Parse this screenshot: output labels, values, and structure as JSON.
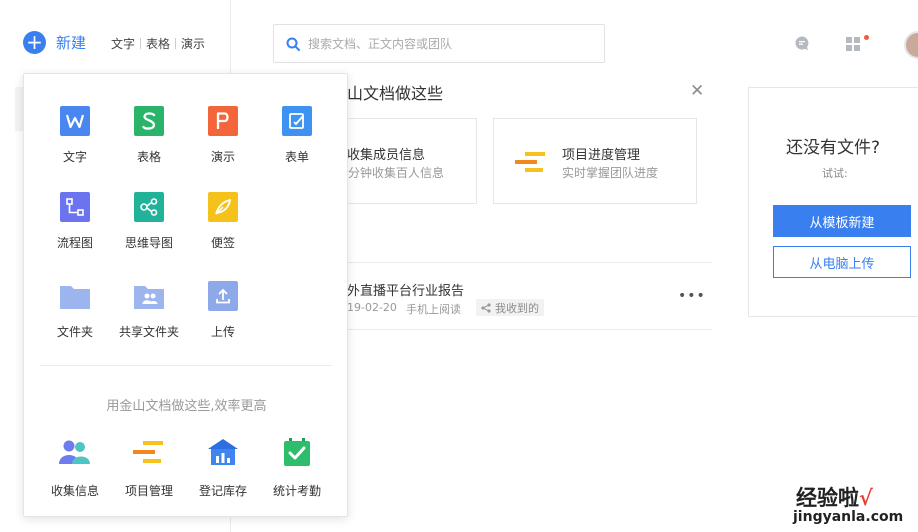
{
  "sidebar": {
    "new_label": "新建",
    "quick_links": [
      "文字",
      "表格",
      "演示"
    ]
  },
  "header": {
    "search_placeholder": "搜索文档、正文内容或团队"
  },
  "recommend": {
    "title": "山文档做这些",
    "cards": [
      {
        "title": "收集成员信息",
        "desc": "分钟收集百人信息"
      },
      {
        "title": "项目进度管理",
        "desc": "实时掌握团队进度"
      }
    ]
  },
  "file_list": {
    "name": "外直播平台行业报告",
    "date": "19-02-20",
    "device": "手机上阅读",
    "tag": "我收到的"
  },
  "empty_panel": {
    "title": "还没有文件?",
    "try_label": "试试:",
    "btn_template": "从模板新建",
    "btn_upload": "从电脑上传"
  },
  "popup": {
    "items": [
      {
        "label": "文字",
        "icon": "w-doc-icon",
        "color": "#4a86f0"
      },
      {
        "label": "表格",
        "icon": "s-sheet-icon",
        "color": "#29b46a"
      },
      {
        "label": "演示",
        "icon": "p-slide-icon",
        "color": "#f5653b"
      },
      {
        "label": "表单",
        "icon": "form-icon",
        "color": "#3e93f2"
      },
      {
        "label": "流程图",
        "icon": "flowchart-icon",
        "color": "#6b74ee"
      },
      {
        "label": "思维导图",
        "icon": "mindmap-icon",
        "color": "#20b39a"
      },
      {
        "label": "便签",
        "icon": "note-icon",
        "color": "#f5c21b"
      },
      {
        "label": "文件夹",
        "icon": "folder-icon",
        "color": "#9db5ee"
      },
      {
        "label": "共享文件夹",
        "icon": "shared-folder-icon",
        "color": "#9db5ee"
      },
      {
        "label": "上传",
        "icon": "upload-icon",
        "color": "#8ea9ea"
      }
    ],
    "subtitle": "用金山文档做这些,效率更高",
    "bottom": [
      {
        "label": "收集信息",
        "icon": "people-icon"
      },
      {
        "label": "项目管理",
        "icon": "gantt-icon"
      },
      {
        "label": "登记库存",
        "icon": "warehouse-icon"
      },
      {
        "label": "统计考勤",
        "icon": "calendar-check-icon"
      }
    ]
  },
  "watermark": {
    "line1": "经验啦",
    "check": "√",
    "line2": "jingyanla.com"
  }
}
